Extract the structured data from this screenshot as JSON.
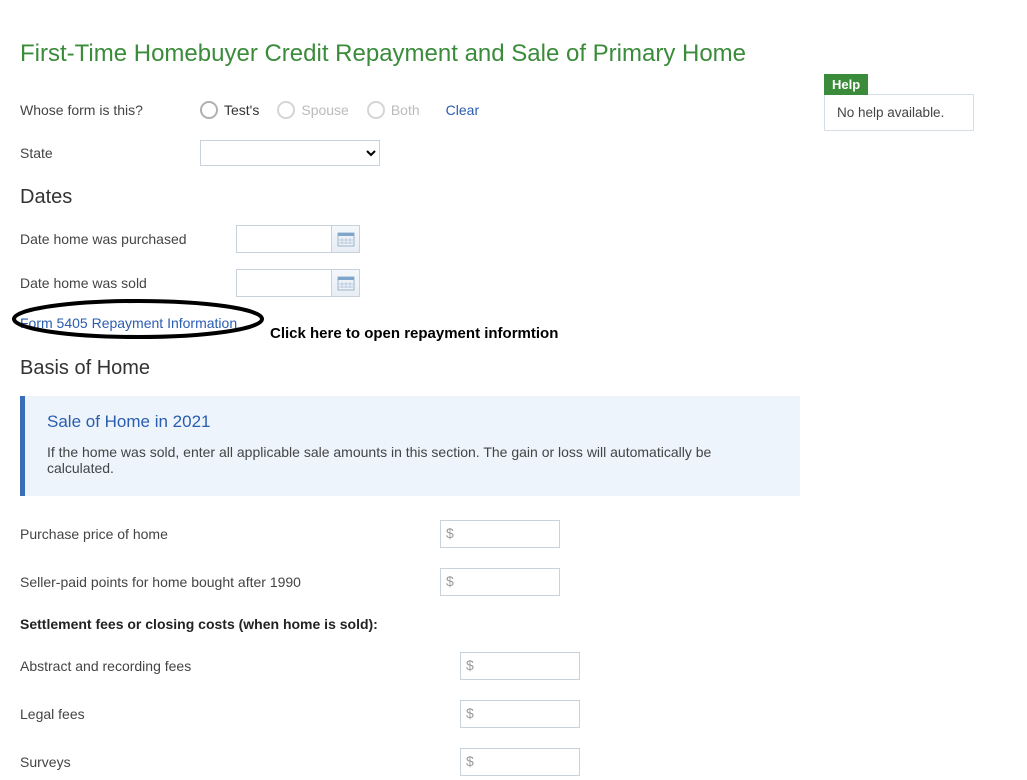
{
  "page_title": "First-Time Homebuyer Credit Repayment and Sale of Primary Home",
  "whose_form": {
    "label": "Whose form is this?",
    "options": [
      {
        "label": "Test's",
        "disabled": false
      },
      {
        "label": "Spouse",
        "disabled": true
      },
      {
        "label": "Both",
        "disabled": true
      }
    ],
    "clear_label": "Clear"
  },
  "state": {
    "label": "State",
    "value": ""
  },
  "dates": {
    "heading": "Dates",
    "purchased_label": "Date home was purchased",
    "sold_label": "Date home was sold",
    "purchased_value": "",
    "sold_value": ""
  },
  "repayment_link": {
    "text": "Form 5405 Repayment Information",
    "annotation": "Click here to open repayment informtion"
  },
  "basis": {
    "heading": "Basis of Home",
    "callout_title": "Sale of Home in 2021",
    "callout_body": "If the home was sold, enter all applicable sale amounts in this section. The gain or loss will automatically be calculated.",
    "rows": {
      "purchase_price": "Purchase price of home",
      "seller_points": "Seller-paid points for home bought after 1990",
      "settlement_heading": "Settlement fees or closing costs (when home is sold):",
      "abstract": "Abstract and recording fees",
      "legal": "Legal fees",
      "surveys": "Surveys"
    },
    "currency_symbol": "$"
  },
  "help": {
    "badge": "Help",
    "body": "No help available."
  }
}
